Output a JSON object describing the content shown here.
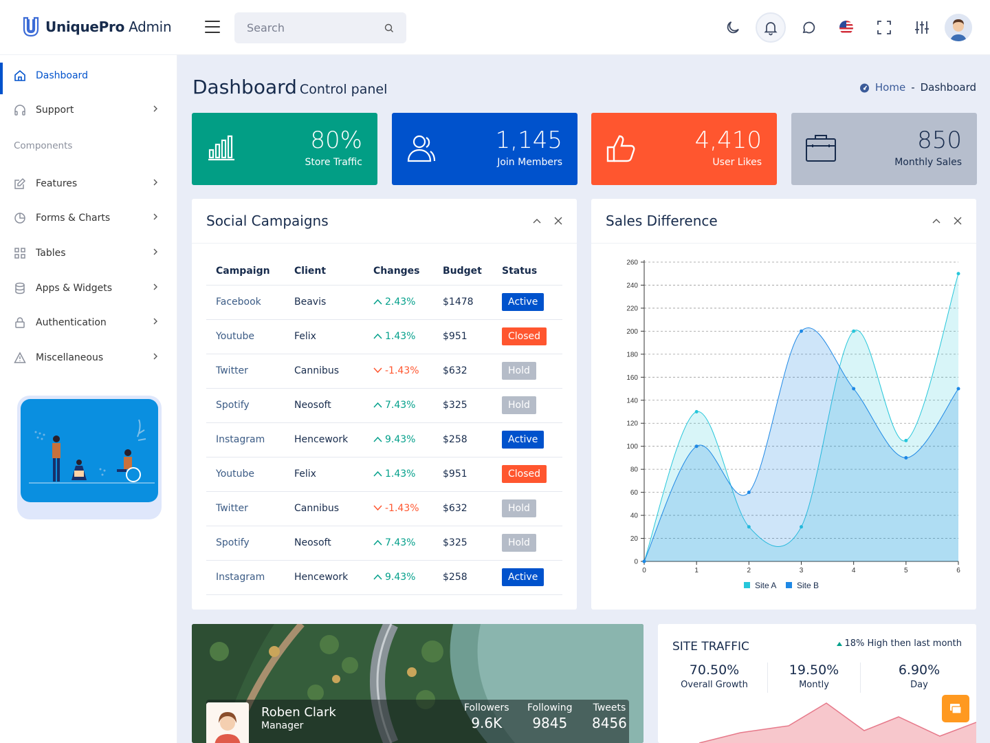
{
  "app": {
    "brand_bold": "UniquePro",
    "brand_rest": " Admin"
  },
  "search": {
    "placeholder": "Search"
  },
  "sidebar": {
    "items": [
      {
        "label": "Dashboard",
        "icon": "home-icon"
      },
      {
        "label": "Support",
        "icon": "headphones-icon"
      },
      {
        "label": "Features",
        "icon": "edit-icon"
      },
      {
        "label": "Forms & Charts",
        "icon": "pie-icon"
      },
      {
        "label": "Tables",
        "icon": "grid-icon"
      },
      {
        "label": "Apps & Widgets",
        "icon": "database-icon"
      },
      {
        "label": "Authentication",
        "icon": "lock-icon"
      },
      {
        "label": "Miscellaneous",
        "icon": "alert-triangle-icon"
      }
    ],
    "section": "Components"
  },
  "page": {
    "title": "Dashboard",
    "subtitle": "Control panel"
  },
  "breadcrumb": {
    "home": "Home",
    "sep": "-",
    "current": "Dashboard"
  },
  "stats": [
    {
      "value": "80%",
      "caption": "Store Traffic",
      "color": "#029e85"
    },
    {
      "value": "1,145",
      "caption": "Join Members",
      "color": "#0052cc"
    },
    {
      "value": "4,410",
      "caption": "User Likes",
      "color": "#ff562f"
    },
    {
      "value": "850",
      "caption": "Monthly Sales",
      "color": "#b6becd"
    }
  ],
  "social": {
    "title": "Social Campaigns",
    "headers": [
      "Campaign",
      "Client",
      "Changes",
      "Budget",
      "Status"
    ],
    "rows": [
      {
        "campaign": "Facebook",
        "client": "Beavis",
        "change": "2.43%",
        "dir": "up",
        "budget": "$1478",
        "status": "Active"
      },
      {
        "campaign": "Youtube",
        "client": "Felix",
        "change": "1.43%",
        "dir": "up",
        "budget": "$951",
        "status": "Closed"
      },
      {
        "campaign": "Twitter",
        "client": "Cannibus",
        "change": "-1.43%",
        "dir": "down",
        "budget": "$632",
        "status": "Hold"
      },
      {
        "campaign": "Spotify",
        "client": "Neosoft",
        "change": "7.43%",
        "dir": "up",
        "budget": "$325",
        "status": "Hold"
      },
      {
        "campaign": "Instagram",
        "client": "Hencework",
        "change": "9.43%",
        "dir": "up",
        "budget": "$258",
        "status": "Active"
      },
      {
        "campaign": "Youtube",
        "client": "Felix",
        "change": "1.43%",
        "dir": "up",
        "budget": "$951",
        "status": "Closed"
      },
      {
        "campaign": "Twitter",
        "client": "Cannibus",
        "change": "-1.43%",
        "dir": "down",
        "budget": "$632",
        "status": "Hold"
      },
      {
        "campaign": "Spotify",
        "client": "Neosoft",
        "change": "7.43%",
        "dir": "up",
        "budget": "$325",
        "status": "Hold"
      },
      {
        "campaign": "Instagram",
        "client": "Hencework",
        "change": "9.43%",
        "dir": "up",
        "budget": "$258",
        "status": "Active"
      }
    ]
  },
  "sales": {
    "title": "Sales Difference"
  },
  "chart_data": {
    "type": "area",
    "x": [
      0,
      1,
      2,
      3,
      4,
      5,
      6
    ],
    "series": [
      {
        "name": "Site A",
        "values": [
          0,
          130,
          30,
          30,
          200,
          105,
          250
        ],
        "color": "#26c6da"
      },
      {
        "name": "Site B",
        "values": [
          0,
          100,
          60,
          200,
          150,
          90,
          150
        ],
        "color": "#1e88e5"
      }
    ],
    "ylim": [
      0,
      260
    ],
    "yticks": [
      0,
      20,
      40,
      60,
      80,
      100,
      120,
      140,
      160,
      180,
      200,
      220,
      240,
      260
    ],
    "xticks": [
      0,
      1,
      2,
      3,
      4,
      5,
      6
    ],
    "grid": true,
    "legend": "bottom"
  },
  "profile": {
    "name": "Roben Clark",
    "role": "Manager",
    "stats": [
      {
        "label": "Followers",
        "value": "9.6K"
      },
      {
        "label": "Following",
        "value": "9845"
      },
      {
        "label": "Tweets",
        "value": "8456"
      }
    ]
  },
  "traffic": {
    "title": "SITE TRAFFIC",
    "note": "18% High then last month",
    "stats": [
      {
        "value": "70.50%",
        "label": "Overall Growth"
      },
      {
        "value": "19.50%",
        "label": "Montly"
      },
      {
        "value": "6.90%",
        "label": "Day"
      }
    ]
  }
}
